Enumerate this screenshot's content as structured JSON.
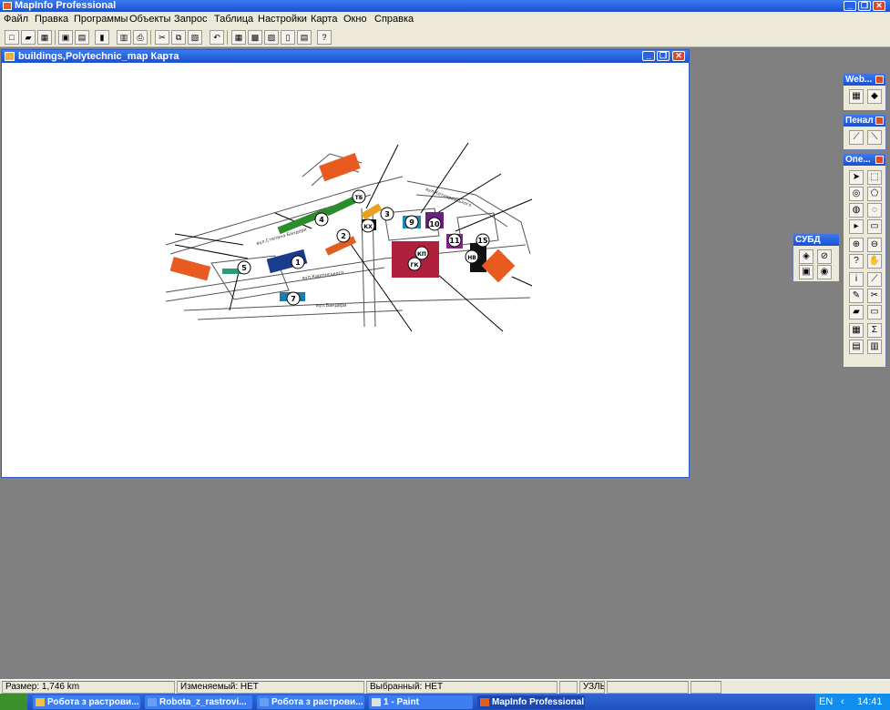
{
  "app": {
    "title": "MapInfo Professional"
  },
  "menu": [
    "Файл",
    "Правка",
    "Программы",
    "Объекты",
    "Запрос",
    "Таблица",
    "Настройки",
    "Карта",
    "Окно",
    "Справка"
  ],
  "map_window": {
    "title": "buildings,Polytechnic_map Карта"
  },
  "map_labels": {
    "street1": "вул.Степана Бандери",
    "street2": "вул.Бандери",
    "street3": "вул.Карпінського",
    "street4": "вул.Котляревського",
    "numbers": [
      "1",
      "2",
      "3",
      "4",
      "5",
      "7",
      "9",
      "10",
      "11",
      "15"
    ],
    "codes": [
      "ТБ",
      "КХ",
      "НВ",
      "ГК",
      "КП"
    ]
  },
  "palettes": {
    "web": "Web...",
    "penal": "Пенал",
    "ope": "Опе...",
    "db": "СУБД"
  },
  "status": {
    "size": "Размер: 1,746 km",
    "editable": "Изменяемый: НЕТ",
    "selected": "Выбранный: НЕТ",
    "nodes": "УЗЛЫ"
  },
  "taskbar": {
    "items": [
      "Робота з растрови...",
      "Robota_z_rastrovi...",
      "Робота з растрови...",
      "1 - Paint",
      "MapInfo Professional"
    ],
    "lang": "EN",
    "clock": "14:41"
  }
}
